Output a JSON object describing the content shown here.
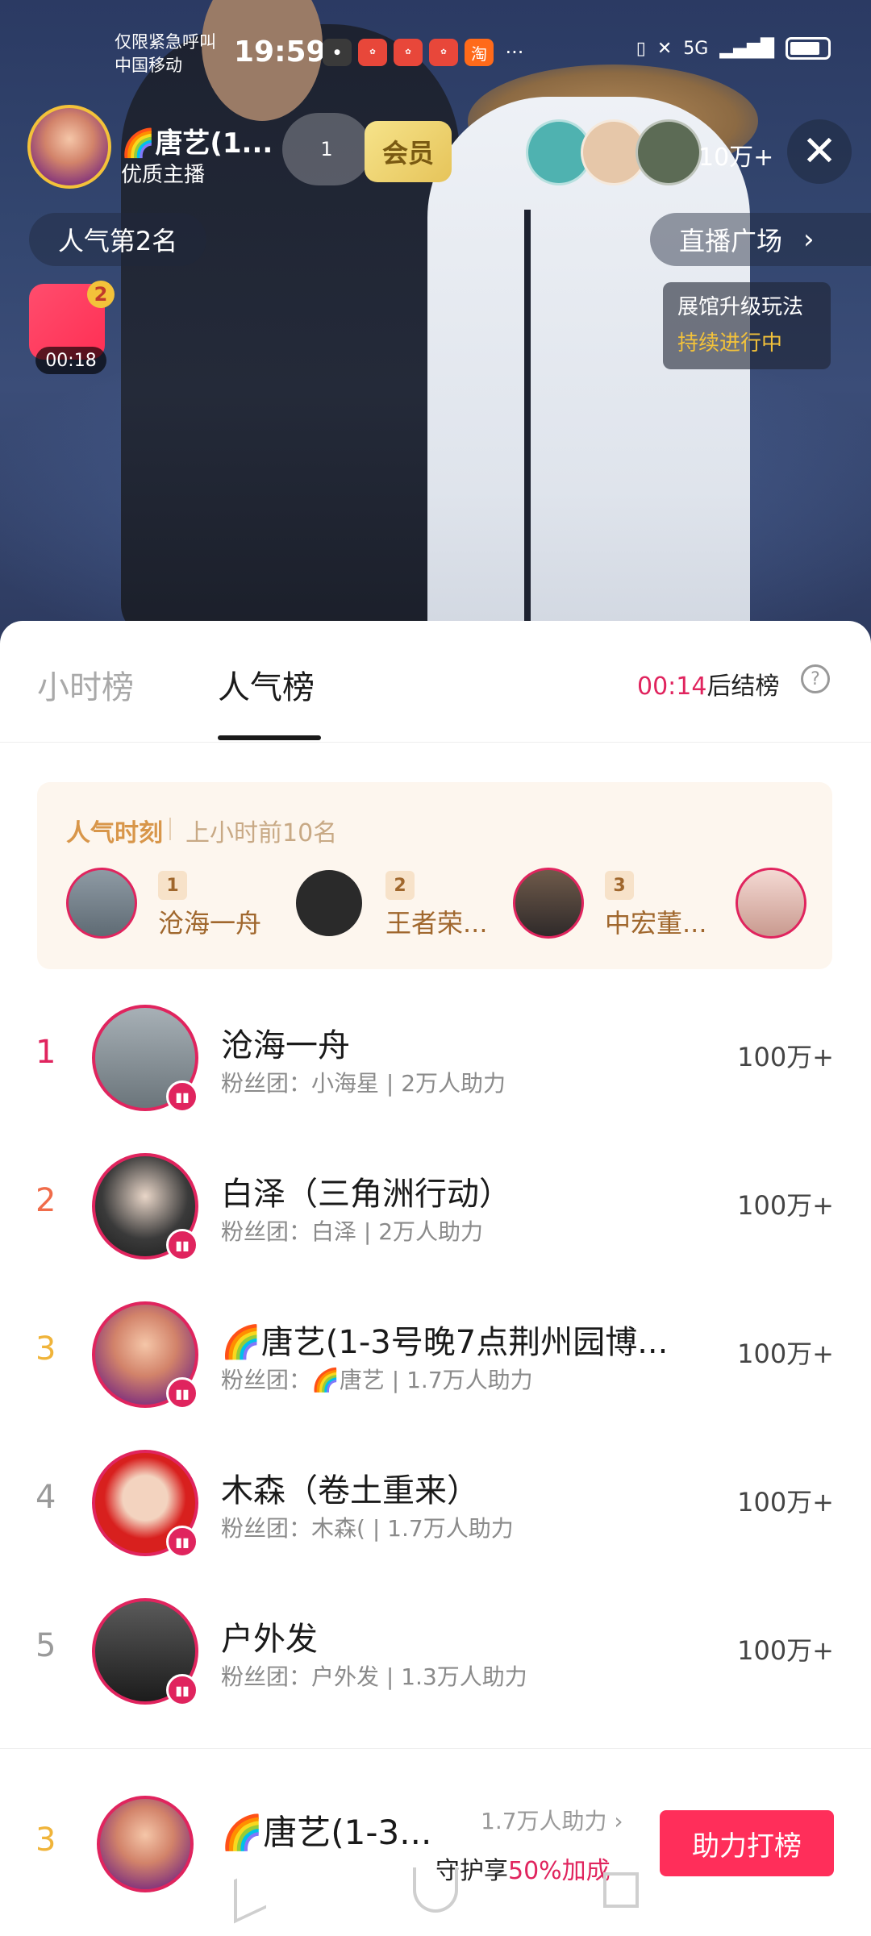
{
  "status_bar": {
    "carrier_line1": "仅限紧急呼叫",
    "carrier_line2": "中国移动",
    "time": "19:59",
    "network": "5G",
    "icons": [
      "wechat-icon",
      "huawei-icon",
      "huawei-icon",
      "huawei-icon",
      "taobao-icon",
      "more-dots-icon",
      "vibrate-icon",
      "signal-icon",
      "battery-icon"
    ]
  },
  "live_header": {
    "host_name": "🌈唐艺(1...",
    "host_tag": "优质主播",
    "likes_badge": "1",
    "vip_label": "会员",
    "viewer_count": "10万+",
    "popularity_rank": "人气第2名",
    "plaza_label": "直播广场",
    "event_title": "展馆升级玩法",
    "event_status": "持续进行中",
    "gift_count": "2",
    "gift_timer": "00:18"
  },
  "sheet": {
    "tabs": [
      {
        "label": "小时榜",
        "active": false
      },
      {
        "label": "人气榜",
        "active": true
      }
    ],
    "countdown_time": "00:14",
    "countdown_suffix": "后结榜",
    "help_icon": "?"
  },
  "moment": {
    "title": "人气时刻",
    "subtitle": "上小时前10名",
    "items": [
      {
        "rank": "1",
        "name": "沧海一舟"
      },
      {
        "rank": "2",
        "name": "王者荣..."
      },
      {
        "rank": "3",
        "name": "中宏董..."
      }
    ]
  },
  "ranking": [
    {
      "rank": "1",
      "name": "沧海一舟",
      "fan": "粉丝团：小海星 | 2万人助力",
      "score": "100万+",
      "rank_color": "#e0245e"
    },
    {
      "rank": "2",
      "name": "白泽（三角洲行动）",
      "fan": "粉丝团：白泽 | 2万人助力",
      "score": "100万+",
      "rank_color": "#f06c4a"
    },
    {
      "rank": "3",
      "name": "🌈唐艺(1-3号晚7点荆州园博...",
      "fan": "粉丝团：🌈唐艺 | 1.7万人助力",
      "score": "100万+",
      "rank_color": "#f0b43a"
    },
    {
      "rank": "4",
      "name": "木森（卷土重来）",
      "fan": "粉丝团：木森( | 1.7万人助力",
      "score": "100万+",
      "rank_color": "#9a9a9a"
    },
    {
      "rank": "5",
      "name": "户外发",
      "fan": "粉丝团：户外发 | 1.3万人助力",
      "score": "100万+",
      "rank_color": "#9a9a9a"
    }
  ],
  "bottom_bar": {
    "rank": "3",
    "name": "🌈唐艺(1-3...",
    "support": "1.7万人助力 ›",
    "guard_prefix": "守护享",
    "guard_highlight": "50%加成",
    "cta": "助力打榜"
  }
}
